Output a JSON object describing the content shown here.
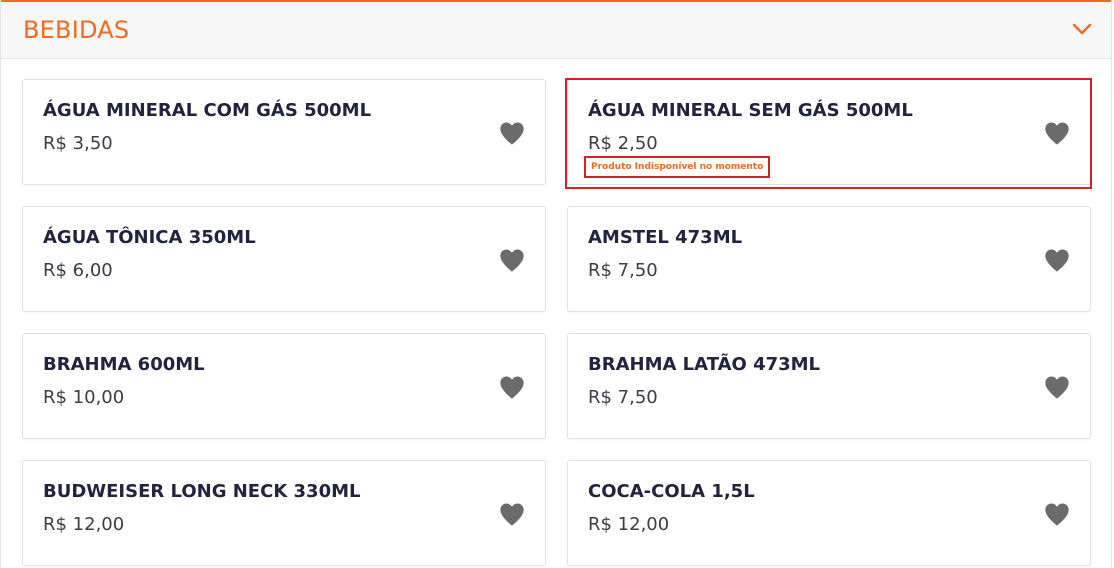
{
  "section": {
    "title": "BEBIDAS"
  },
  "icons": {
    "toggle": "chevron-down-icon",
    "favorite": "heart-icon"
  },
  "colors": {
    "accent": "#f26b1d",
    "highlight": "#d32027",
    "heart": "#6b6b6b",
    "product_name": "#23233f"
  },
  "products": [
    {
      "name": "ÁGUA MINERAL COM GÁS 500ML",
      "price": "R$ 3,50"
    },
    {
      "name": "ÁGUA MINERAL SEM GÁS 500ML",
      "price": "R$ 2,50",
      "notice": "Produto Indisponível no momento"
    },
    {
      "name": "ÁGUA TÔNICA 350ML",
      "price": "R$ 6,00"
    },
    {
      "name": "AMSTEL 473ML",
      "price": "R$ 7,50"
    },
    {
      "name": "BRAHMA 600ML",
      "price": "R$ 10,00"
    },
    {
      "name": "BRAHMA LATÃO 473ML",
      "price": "R$ 7,50"
    },
    {
      "name": "BUDWEISER LONG NECK 330ML",
      "price": "R$ 12,00"
    },
    {
      "name": "COCA-COLA 1,5L",
      "price": "R$ 12,00"
    }
  ]
}
